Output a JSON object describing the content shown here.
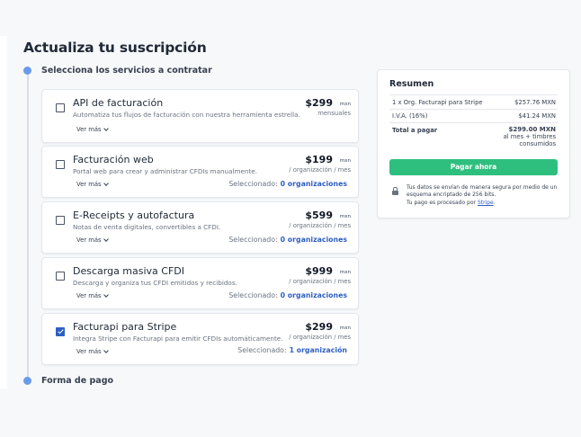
{
  "page": {
    "title": "Actualiza tu suscripción"
  },
  "steps": {
    "services": "Selecciona los servicios a contratar",
    "payment": "Forma de pago"
  },
  "common": {
    "ver_mas": "Ver más",
    "selected_label": "Seleccionado:"
  },
  "services": [
    {
      "name": "API de facturación",
      "description": "Automatiza tus flujos de facturación con nuestra herramienta estrella.",
      "price": "$299",
      "unit": "mxn",
      "period": "mensuales",
      "checked": false
    },
    {
      "name": "Facturación web",
      "description": "Portal web para crear y administrar CFDIs manualmente.",
      "price": "$199",
      "unit": "mxn",
      "period": "/ organización / mes",
      "selected": "0 organizaciones",
      "checked": false
    },
    {
      "name": "E-Receipts y autofactura",
      "description": "Notas de venta digitales, convertibles a CFDI.",
      "price": "$599",
      "unit": "mxn",
      "period": "/ organización / mes",
      "selected": "0 organizaciones",
      "checked": false
    },
    {
      "name": "Descarga masiva CFDI",
      "description": "Descarga y organiza tus CFDI emitidos y recibidos.",
      "price": "$999",
      "unit": "mxn",
      "period": "/ organización / mes",
      "selected": "0 organizaciones",
      "checked": false
    },
    {
      "name": "Facturapi para Stripe",
      "description": "Integra Stripe con Facturapi para emitir CFDIs automáticamente.",
      "price": "$299",
      "unit": "mxn",
      "period": "/ organización / mes",
      "selected": "1 organización",
      "checked": true
    }
  ],
  "summary": {
    "title": "Resumen",
    "line_item": {
      "label": "1 x Org. Facturapi para Stripe",
      "amount": "$257.76 MXN"
    },
    "tax": {
      "label": "I.V.A. (16%)",
      "amount": "$41.24 MXN"
    },
    "total": {
      "label": "Total a pagar",
      "amount": "$299.00 MXN",
      "note_1": "al mes + timbres",
      "note_2": "consumidos"
    },
    "pay_button": "Pagar ahora",
    "security_text": "Tus datos se envían de manera segura por medio de un esquema encriptado de 256 bits.",
    "processed_by": "Tu pago es procesado por",
    "processor": "Stripe",
    "processor_suffix": "."
  },
  "colors": {
    "accent": "#2f5fc4",
    "pay_button": "#2ebf7e",
    "step_dot": "#6b9be8"
  }
}
